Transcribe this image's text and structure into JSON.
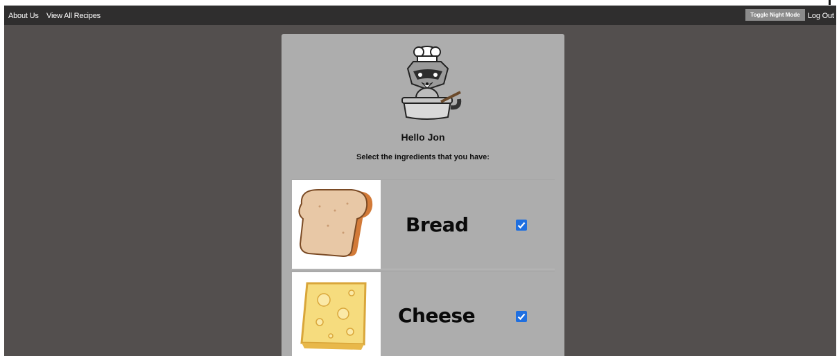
{
  "navbar": {
    "links": [
      {
        "label": "About Us"
      },
      {
        "label": "View All Recipes"
      }
    ],
    "toggle_label": "Toggle Night Mode",
    "logout_label": "Log Out"
  },
  "card": {
    "mascot_icon": "raccoon-chef-icon",
    "greeting": "Hello Jon",
    "prompt": "Select the ingredients that you have:"
  },
  "ingredients": [
    {
      "name": "Bread",
      "icon": "bread-icon",
      "checked": true
    },
    {
      "name": "Cheese",
      "icon": "cheese-icon",
      "checked": true
    }
  ],
  "colors": {
    "navbar": "#2f2e2e",
    "page_background": "#534f4e",
    "card": "#adadad",
    "checkbox": "#1f6fe0"
  }
}
